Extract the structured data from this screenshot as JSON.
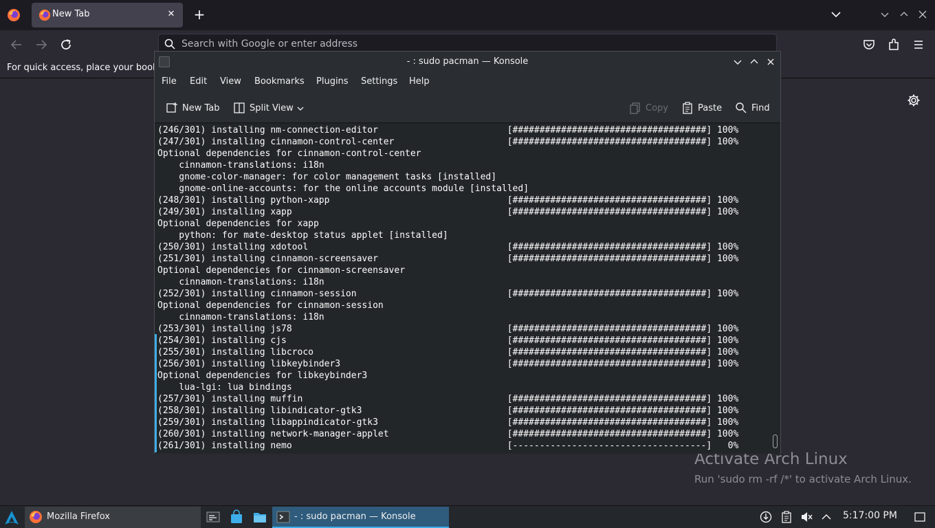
{
  "firefox": {
    "tab_title": "New Tab",
    "url_placeholder": "Search with Google or enter address",
    "bookmarks_hint": "For quick access, place your bookm"
  },
  "konsole": {
    "title": "- : sudo pacman — Konsole",
    "menu": [
      "File",
      "Edit",
      "View",
      "Bookmarks",
      "Plugins",
      "Settings",
      "Help"
    ],
    "toolbar": {
      "new_tab": "New Tab",
      "split_view": "Split View",
      "copy": "Copy",
      "paste": "Paste",
      "find": "Find"
    },
    "terminal_lines": [
      "(246/301) installing nm-connection-editor                        [####################################] 100%",
      "(247/301) installing cinnamon-control-center                     [####################################] 100%",
      "Optional dependencies for cinnamon-control-center",
      "    cinnamon-translations: i18n",
      "    gnome-color-manager: for color management tasks [installed]",
      "    gnome-online-accounts: for the online accounts module [installed]",
      "(248/301) installing python-xapp                                 [####################################] 100%",
      "(249/301) installing xapp                                        [####################################] 100%",
      "Optional dependencies for xapp",
      "    python: for mate-desktop status applet [installed]",
      "(250/301) installing xdotool                                     [####################################] 100%",
      "(251/301) installing cinnamon-screensaver                        [####################################] 100%",
      "Optional dependencies for cinnamon-screensaver",
      "    cinnamon-translations: i18n",
      "(252/301) installing cinnamon-session                            [####################################] 100%",
      "Optional dependencies for cinnamon-session",
      "    cinnamon-translations: i18n",
      "(253/301) installing js78                                        [####################################] 100%",
      "(254/301) installing cjs                                         [####################################] 100%",
      "(255/301) installing libcroco                                    [####################################] 100%",
      "(256/301) installing libkeybinder3                               [####################################] 100%",
      "Optional dependencies for libkeybinder3",
      "    lua-lgi: lua bindings",
      "(257/301) installing muffin                                      [####################################] 100%",
      "(258/301) installing libindicator-gtk3                           [####################################] 100%",
      "(259/301) installing libappindicator-gtk3                        [####################################] 100%",
      "(260/301) installing network-manager-applet                      [####################################] 100%",
      "(261/301) installing nemo                                        [------------------------------------]   0%"
    ]
  },
  "watermark": {
    "title": "Activate Arch Linux",
    "subtitle": "Run 'sudo rm -rf /*' to activate Arch Linux."
  },
  "taskbar": {
    "firefox_task": "Mozilla Firefox",
    "konsole_task": "- : sudo pacman — Konsole",
    "clock": "5:17:00 PM"
  },
  "colors": {
    "accent": "#3daee9",
    "terminal_bg": "#232629",
    "firefox_bg": "#2b2a33"
  }
}
